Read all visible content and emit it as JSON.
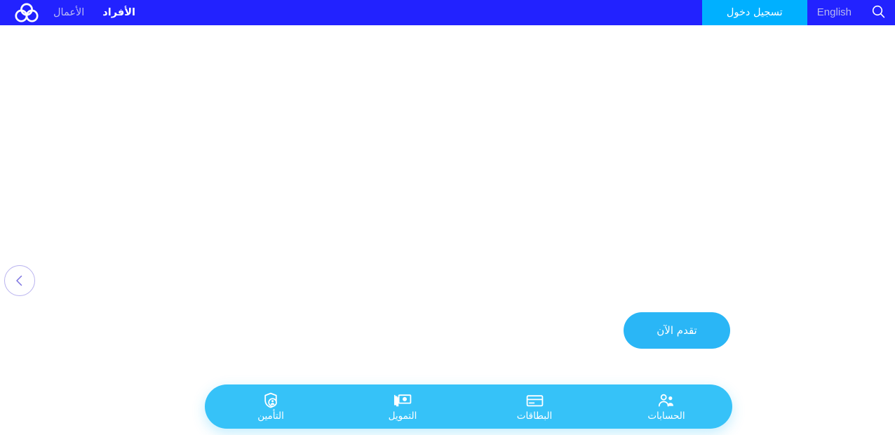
{
  "header": {
    "brand_icon": "trefoil-three-circles-logo",
    "nav_items": [
      {
        "label": "الأفراد",
        "active": true
      },
      {
        "label": "الأعمال",
        "active": false
      }
    ],
    "search_icon": "search-icon",
    "language_toggle": "English",
    "login_label": "تسجيل دخول",
    "background_color": "#2222ff",
    "login_background_color": "#00b0ff"
  },
  "hero": {
    "prev_icon": "chevron-left-icon",
    "cta_label": "تقدم الآن",
    "cta_color": "#2ab6f6",
    "background_color": "#ffffff"
  },
  "quickbar": {
    "background_color": "#36c2f8",
    "items": [
      {
        "label": "الحسابات",
        "icon": "people-accounts-icon"
      },
      {
        "label": "البطاقات",
        "icon": "credit-card-icon"
      },
      {
        "label": "التمويل",
        "icon": "banknotes-money-icon"
      },
      {
        "label": "التأمين",
        "icon": "shield-person-insurance-icon"
      }
    ]
  }
}
